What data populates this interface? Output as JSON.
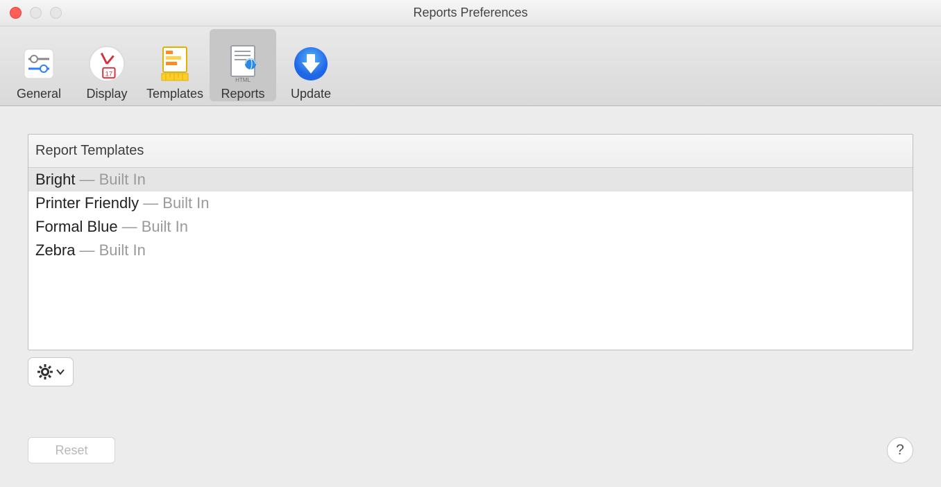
{
  "window": {
    "title": "Reports Preferences"
  },
  "toolbar": {
    "items": [
      {
        "id": "general",
        "label": "General"
      },
      {
        "id": "display",
        "label": "Display"
      },
      {
        "id": "templates",
        "label": "Templates"
      },
      {
        "id": "reports",
        "label": "Reports",
        "active": true
      },
      {
        "id": "update",
        "label": "Update"
      }
    ]
  },
  "templates": {
    "header": "Report Templates",
    "separator": " — ",
    "meta_label": "Built In",
    "rows": [
      {
        "name": "Bright",
        "meta": "Built In",
        "selected": true
      },
      {
        "name": "Printer Friendly",
        "meta": "Built In",
        "selected": false
      },
      {
        "name": "Formal Blue",
        "meta": "Built In",
        "selected": false
      },
      {
        "name": "Zebra",
        "meta": "Built In",
        "selected": false
      }
    ]
  },
  "actions": {
    "reset": "Reset",
    "help": "?"
  }
}
